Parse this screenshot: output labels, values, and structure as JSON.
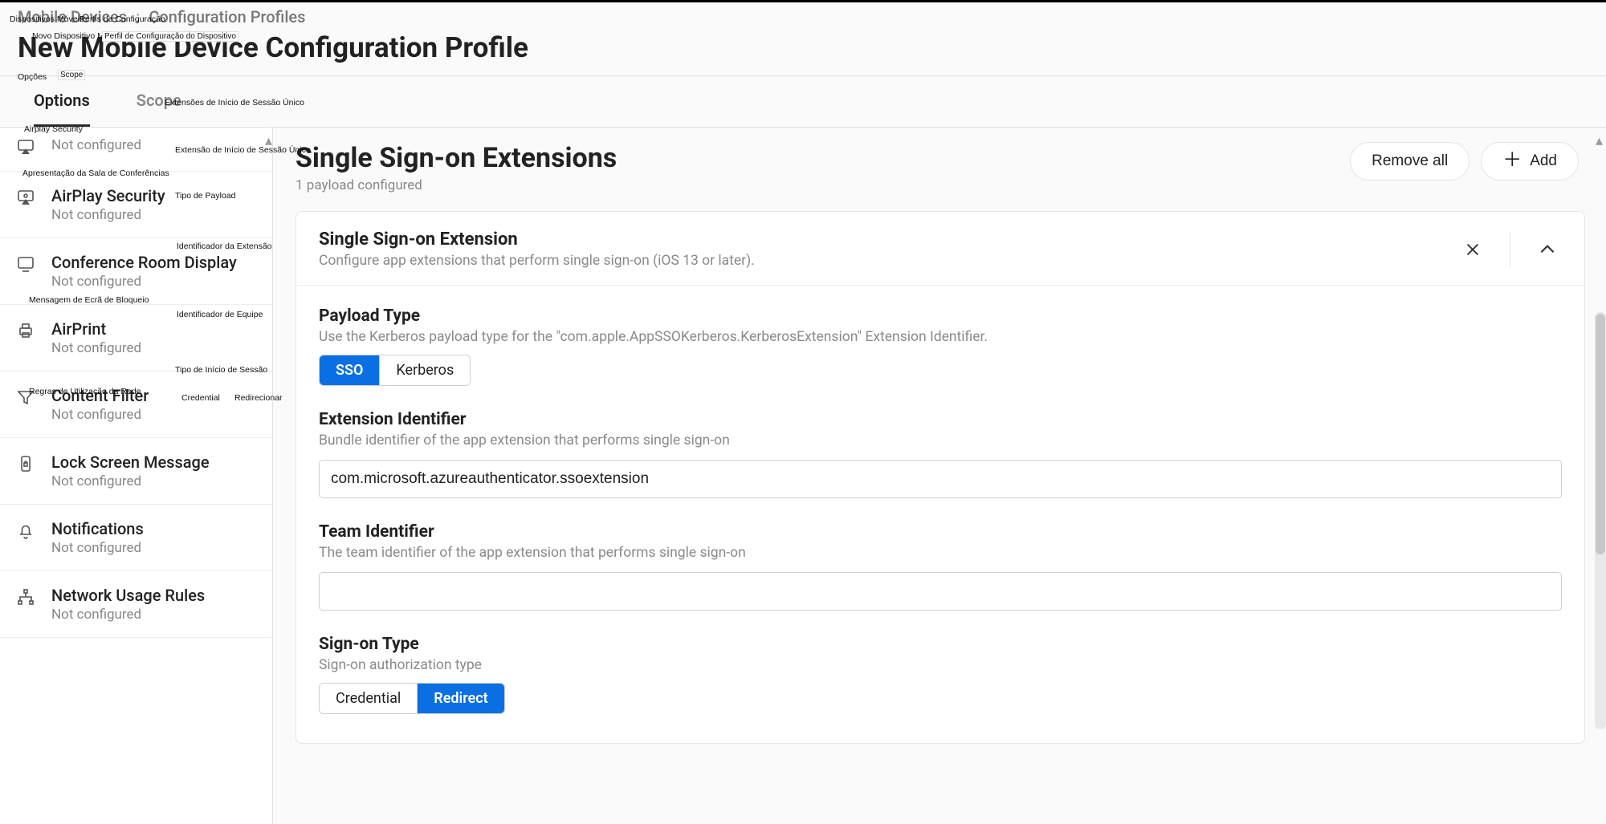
{
  "breadcrumb": {
    "part1": "Mobile Devices",
    "sep": ":",
    "part2": "Configuration Profiles"
  },
  "page_title": "New Mobile Device Configuration Profile",
  "tabs": {
    "options": "Options",
    "scope": "Scope"
  },
  "sidebar": {
    "items": [
      {
        "title": "",
        "sub": "Not configured"
      },
      {
        "title": "AirPlay Security",
        "sub": "Not configured"
      },
      {
        "title": "Conference Room Display",
        "sub": "Not configured"
      },
      {
        "title": "AirPrint",
        "sub": "Not configured"
      },
      {
        "title": "Content Filter",
        "sub": "Not configured"
      },
      {
        "title": "Lock Screen Message",
        "sub": "Not configured"
      },
      {
        "title": "Notifications",
        "sub": "Not configured"
      },
      {
        "title": "Network Usage Rules",
        "sub": "Not configured"
      }
    ]
  },
  "actions": {
    "remove_all": "Remove all",
    "add": "Add"
  },
  "content": {
    "title": "Single Sign-on Extensions",
    "subtitle": "1 payload configured"
  },
  "card": {
    "title": "Single Sign-on Extension",
    "desc": "Configure app extensions that perform single sign-on (iOS 13 or later)."
  },
  "payload_type": {
    "label": "Payload Type",
    "hint": "Use the Kerberos payload type for the \"com.apple.AppSSOKerberos.KerberosExtension\" Extension Identifier.",
    "opt_sso": "SSO",
    "opt_kerberos": "Kerberos"
  },
  "ext_id": {
    "label": "Extension Identifier",
    "hint": "Bundle identifier of the app extension that performs single sign-on",
    "value": "com.microsoft.azureauthenticator.ssoextension"
  },
  "team_id": {
    "label": "Team Identifier",
    "hint": "The team identifier of the app extension that performs single sign-on",
    "value": ""
  },
  "signon_type": {
    "label": "Sign-on Type",
    "hint": "Sign-on authorization type",
    "opt_credential": "Credential",
    "opt_redirect": "Redirect"
  },
  "overlays": {
    "o1": "Dispositivos Móveis:",
    "o2": "Perfis de Configuração",
    "o3": "Novo Dispositivo Móvel",
    "o4": "Perfil de Configuração do Dispositivo",
    "o5": "Opções",
    "o6": "Scope",
    "o7": "Extensões de Início de Sessão Único",
    "o8": "Extensão de Início de Sessão Único",
    "o9": "Airplay Security",
    "o10": "Apresentação da Sala de Conferências",
    "o11": "Tipo de Payload",
    "o12": "Identificador da Extensão",
    "o13": "Mensagem de Ecrã de Bloqueio",
    "o14": "Identificador de Equipe",
    "o15": "Tipo de Início de Sessão",
    "o16": "Regras de Utilização da Rede",
    "o17": "Credential",
    "o18": "Redirecionar"
  }
}
